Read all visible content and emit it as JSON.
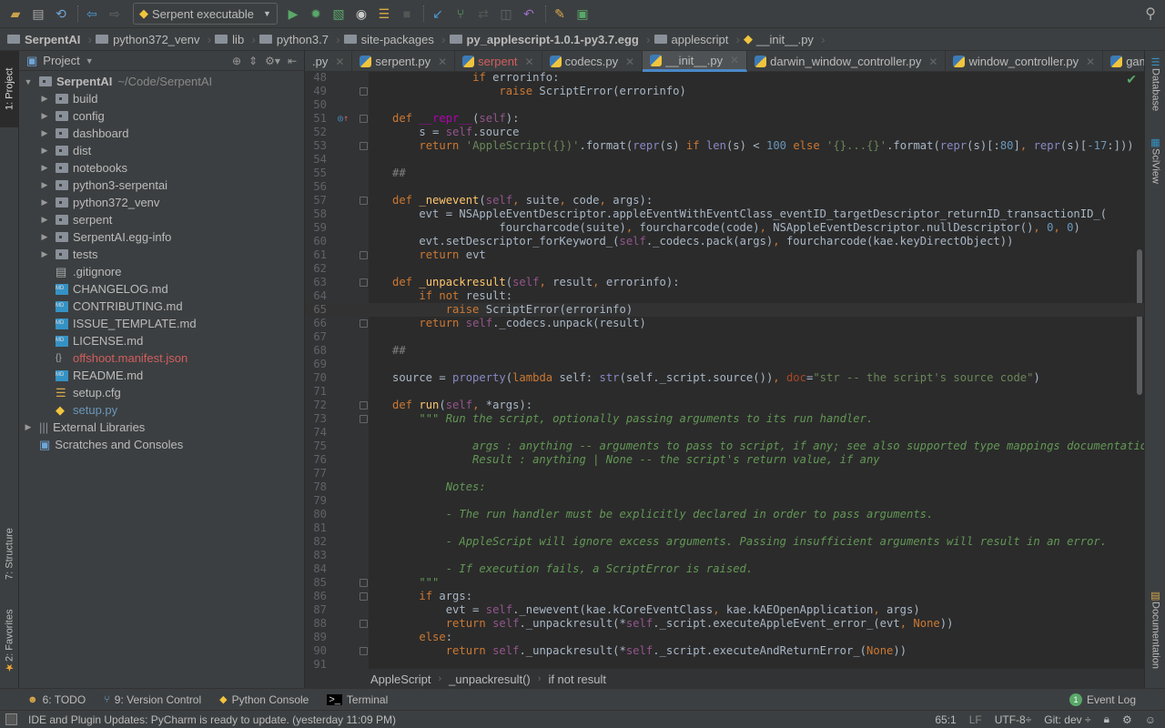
{
  "toolbar": {
    "run_config": "Serpent executable",
    "icons": [
      "open-folder-icon",
      "save-icon",
      "sync-icon",
      "back-icon",
      "forward-icon",
      "run-icon",
      "debug-icon",
      "coverage-icon",
      "profile-icon",
      "concurrency-icon",
      "stop-icon",
      "vcs-update-icon",
      "vcs-commit-icon",
      "vcs-compare-icon",
      "vcs-history-icon",
      "revert-icon",
      "settings-icon",
      "sdk-icon",
      "search-icon"
    ]
  },
  "navbar": {
    "crumbs": [
      "SerpentAI",
      "python372_venv",
      "lib",
      "python3.7",
      "site-packages",
      "py_applescript-1.0.1-py3.7.egg",
      "applescript",
      "__init__.py"
    ]
  },
  "left_strip": {
    "project": "1: Project",
    "structure": "7: Structure",
    "favorites": "2: Favorites"
  },
  "right_strip": {
    "database": "Database",
    "sciview": "SciView",
    "documentation": "Documentation"
  },
  "project_panel": {
    "title": "Project",
    "root": {
      "name": "SerpentAI",
      "path": "~/Code/SerpentAI"
    },
    "folders": [
      "build",
      "config",
      "dashboard",
      "dist",
      "notebooks",
      "python3-serpentai",
      "python372_venv",
      "serpent",
      "SerpentAI.egg-info",
      "tests"
    ],
    "files": [
      {
        "name": ".gitignore",
        "type": "text",
        "color": "normal"
      },
      {
        "name": "CHANGELOG.md",
        "type": "md",
        "color": "normal"
      },
      {
        "name": "CONTRIBUTING.md",
        "type": "md",
        "color": "normal"
      },
      {
        "name": "ISSUE_TEMPLATE.md",
        "type": "md",
        "color": "normal"
      },
      {
        "name": "LICENSE.md",
        "type": "md",
        "color": "normal"
      },
      {
        "name": "offshoot.manifest.json",
        "type": "json",
        "color": "red"
      },
      {
        "name": "README.md",
        "type": "md",
        "color": "normal"
      },
      {
        "name": "setup.cfg",
        "type": "cfg",
        "color": "normal"
      },
      {
        "name": "setup.py",
        "type": "py",
        "color": "blue"
      }
    ],
    "external_libraries": "External Libraries",
    "scratches": "Scratches and Consoles"
  },
  "tabs": [
    {
      "label": ".py",
      "active": false,
      "color": "normal"
    },
    {
      "label": "serpent.py",
      "active": false,
      "color": "normal"
    },
    {
      "label": "serpent",
      "active": false,
      "color": "red"
    },
    {
      "label": "codecs.py",
      "active": false,
      "color": "normal"
    },
    {
      "label": "__init__.py",
      "active": true,
      "color": "normal"
    },
    {
      "label": "darwin_window_controller.py",
      "active": false,
      "color": "normal"
    },
    {
      "label": "window_controller.py",
      "active": false,
      "color": "normal"
    },
    {
      "label": "game.py",
      "active": false,
      "color": "normal"
    }
  ],
  "tabs_overflow": "1",
  "editor": {
    "current_line": 65,
    "lines": [
      {
        "n": "48",
        "html": "            <span class='kw'>if</span> errorinfo:"
      },
      {
        "n": "49",
        "html": "                <span class='kw'>raise</span> ScriptError(errorinfo)"
      },
      {
        "n": "50",
        "html": ""
      },
      {
        "n": "51",
        "html": "<span class='kw'>def</span> <span class='dunder'>__repr__</span>(<span class='sf'>self</span>):"
      },
      {
        "n": "52",
        "html": "    s = <span class='sf'>self</span>.source"
      },
      {
        "n": "53",
        "html": "    <span class='kw'>return</span> <span class='st'>'AppleScript({})'</span>.format(<span class='bi'>repr</span>(s) <span class='kw'>if</span> <span class='bi'>len</span>(s) &lt; <span class='nm'>100</span> <span class='kw'>else</span> <span class='st'>'{}...{}'</span>.format(<span class='bi'>repr</span>(s)[:<span class='nm'>80</span>]<span class='kw'>,</span> <span class='bi'>repr</span>(s)[<span class='nm'>-17</span>:]))"
      },
      {
        "n": "54",
        "html": ""
      },
      {
        "n": "55",
        "html": "<span class='cm'>##</span>"
      },
      {
        "n": "56",
        "html": ""
      },
      {
        "n": "57",
        "html": "<span class='kw'>def</span> <span class='fn'>_newevent</span>(<span class='sf'>self</span><span class='kw'>,</span> suite<span class='kw'>,</span> code<span class='kw'>,</span> args):"
      },
      {
        "n": "58",
        "html": "    evt = NSAppleEventDescriptor.appleEventWithEventClass_eventID_targetDescriptor_returnID_transactionID_("
      },
      {
        "n": "59",
        "html": "                fourcharcode(suite)<span class='kw'>,</span> fourcharcode(code)<span class='kw'>,</span> NSAppleEventDescriptor.nullDescriptor()<span class='kw'>,</span> <span class='nm'>0</span><span class='kw'>,</span> <span class='nm'>0</span>)"
      },
      {
        "n": "60",
        "html": "    evt.setDescriptor_forKeyword_(<span class='sf'>self</span>._codecs.pack(args)<span class='kw'>,</span> fourcharcode(kae.keyDirectObject))"
      },
      {
        "n": "61",
        "html": "    <span class='kw'>return</span> evt"
      },
      {
        "n": "62",
        "html": ""
      },
      {
        "n": "63",
        "html": "<span class='kw'>def</span> <span class='fn'>_unpackresult</span>(<span class='sf'>self</span><span class='kw'>,</span> result<span class='kw'>,</span> errorinfo):"
      },
      {
        "n": "64",
        "html": "    <span class='kw'>if not</span> result:"
      },
      {
        "n": "65",
        "html": "        <span class='kw'>raise</span> ScriptError(errorinfo)"
      },
      {
        "n": "66",
        "html": "    <span class='kw'>return</span> <span class='sf'>self</span>._codecs.unpack(result)"
      },
      {
        "n": "67",
        "html": ""
      },
      {
        "n": "68",
        "html": "<span class='cm'>##</span>"
      },
      {
        "n": "69",
        "html": ""
      },
      {
        "n": "70",
        "html": "source = <span class='bi'>property</span>(<span class='kw'>lambda</span> self: <span class='bi'>str</span>(self._script.source())<span class='kw'>,</span> <span class='param'>doc</span>=<span class='st'>\"str -- the script's source code\"</span>)"
      },
      {
        "n": "71",
        "html": ""
      },
      {
        "n": "72",
        "html": "<span class='kw'>def</span> <span class='fn'>run</span>(<span class='sf'>self</span><span class='kw'>,</span> *args):"
      },
      {
        "n": "73",
        "html": "    <span class='doc'>\"\"\" Run the script, optionally passing arguments to its run handler.</span>"
      },
      {
        "n": "74",
        "html": ""
      },
      {
        "n": "75",
        "html": "<span class='doc'>            args : anything -- arguments to pass to script, if any; see also supported type mappings documentation</span>"
      },
      {
        "n": "76",
        "html": "<span class='doc'>            Result : anything | None -- the script's return value, if any</span>"
      },
      {
        "n": "77",
        "html": ""
      },
      {
        "n": "78",
        "html": "<span class='doc'>        Notes:</span>"
      },
      {
        "n": "79",
        "html": ""
      },
      {
        "n": "80",
        "html": "<span class='doc'>        - The run handler must be explicitly declared in order to pass arguments.</span>"
      },
      {
        "n": "81",
        "html": ""
      },
      {
        "n": "82",
        "html": "<span class='doc'>        - AppleScript will ignore excess arguments. Passing insufficient arguments will result in an error.</span>"
      },
      {
        "n": "83",
        "html": ""
      },
      {
        "n": "84",
        "html": "<span class='doc'>        - If execution fails, a ScriptError is raised.</span>"
      },
      {
        "n": "85",
        "html": "<span class='doc'>    \"\"\"</span>"
      },
      {
        "n": "86",
        "html": "    <span class='kw'>if</span> args:"
      },
      {
        "n": "87",
        "html": "        evt = <span class='sf'>self</span>._newevent(kae.kCoreEventClass<span class='kw'>,</span> kae.kAEOpenApplication<span class='kw'>,</span> args)"
      },
      {
        "n": "88",
        "html": "        <span class='kw'>return</span> <span class='sf'>self</span>._unpackresult(*<span class='sf'>self</span>._script.executeAppleEvent_error_(evt<span class='kw'>,</span> <span class='kw'>None</span>))"
      },
      {
        "n": "89",
        "html": "    <span class='kw'>else</span>:"
      },
      {
        "n": "90",
        "html": "        <span class='kw'>return</span> <span class='sf'>self</span>._unpackresult(*<span class='sf'>self</span>._script.executeAndReturnError_(<span class='kw'>None</span>))"
      },
      {
        "n": "91",
        "html": ""
      }
    ]
  },
  "code_breadcrumb": [
    "AppleScript",
    "_unpackresult()",
    "if not result"
  ],
  "bottom_tabs": [
    {
      "label": "6: TODO",
      "icon": "todo-icon"
    },
    {
      "label": "9: Version Control",
      "icon": "vcs-icon"
    },
    {
      "label": "Python Console",
      "icon": "python-icon"
    },
    {
      "label": "Terminal",
      "icon": "terminal-icon"
    }
  ],
  "event_log": {
    "label": "Event Log",
    "count": "1"
  },
  "status": {
    "message": "IDE and Plugin Updates: PyCharm is ready to update. (yesterday 11:09 PM)",
    "position": "65:1",
    "line_sep": "LF",
    "encoding": "UTF-8÷",
    "git": "Git: dev ÷"
  }
}
